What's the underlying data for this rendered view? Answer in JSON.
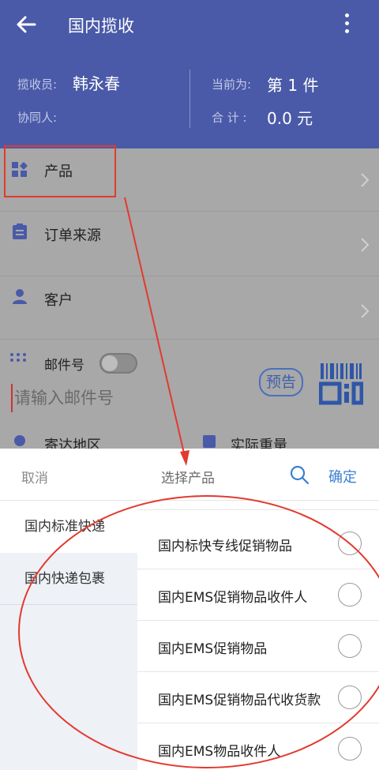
{
  "appbar": {
    "title": "国内揽收"
  },
  "summary": {
    "collector_label": "揽收员:",
    "collector_name": "韩永春",
    "assistant_label": "协同人:",
    "current_label": "当前为:",
    "current_value": "第 1 件",
    "total_label": "合 计 :",
    "total_value": "0.0 元"
  },
  "form": {
    "product_label": "产品",
    "order_source_label": "订单来源",
    "customer_label": "客户",
    "mail_no_label": "邮件号",
    "mail_no_placeholder": "请输入邮件号",
    "prenotice_label": "预告",
    "region_label": "寄达地区",
    "weight_label": "实际重量"
  },
  "sheet": {
    "cancel_label": "取消",
    "title": "选择产品",
    "confirm_label": "确定",
    "categories": [
      {
        "label": "国内标准快递"
      },
      {
        "label": "国内快递包裹"
      }
    ],
    "products": [
      {
        "label": "国内标快专线促销物品"
      },
      {
        "label": "国内EMS促销物品收件人"
      },
      {
        "label": "国内EMS促销物品"
      },
      {
        "label": "国内EMS促销物品代收货款"
      },
      {
        "label": "国内EMS物品收件人"
      }
    ]
  },
  "colors": {
    "primary": "#4a5aa8",
    "accent_blue": "#3a7fd0",
    "annotation_red": "#e23a2f"
  }
}
